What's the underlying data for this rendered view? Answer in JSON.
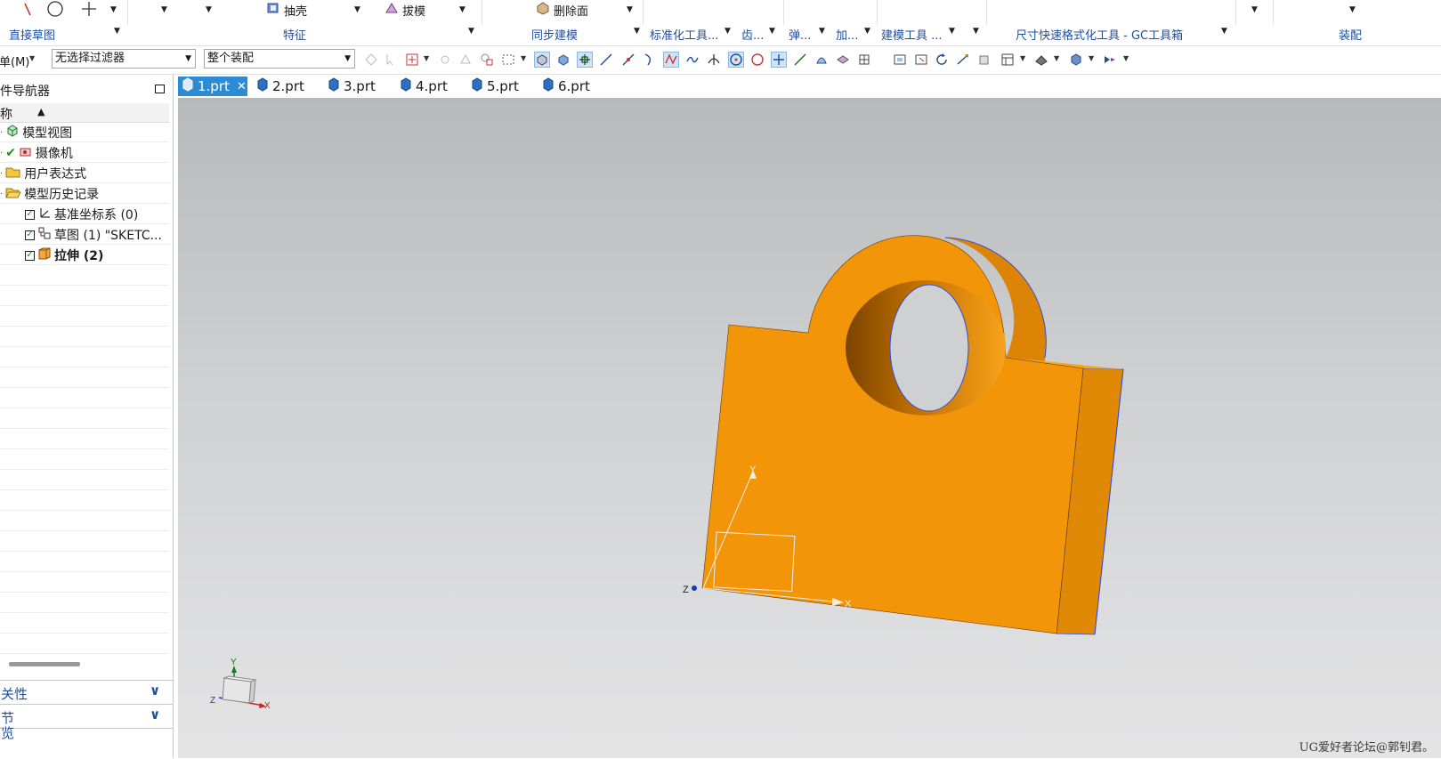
{
  "ribbon": {
    "items": [
      "抽壳",
      "拔模",
      "删除面"
    ],
    "groups": [
      "直接草图",
      "特征",
      "同步建模",
      "标准化工具...",
      "齿...",
      "弹...",
      "加...",
      "建模工具 ...",
      "尺寸快速格式化工具 - GC工具箱",
      "装配"
    ]
  },
  "toolbar": {
    "menu_label": "菜单(M)",
    "filter_value": "无选择过滤器",
    "scope_value": "整个装配"
  },
  "navigator": {
    "title": "部件导航器",
    "column_name": "名称",
    "items": [
      {
        "label": "模型视图",
        "icon": "model-view-icon"
      },
      {
        "label": "摄像机",
        "icon": "camera-icon"
      },
      {
        "label": "用户表达式",
        "icon": "folder-icon"
      },
      {
        "label": "模型历史记录",
        "icon": "folder-open-icon"
      },
      {
        "label": "基准坐标系 (0)",
        "icon": "datum-csys-icon"
      },
      {
        "label": "草图 (1) \"SKETC...",
        "icon": "sketch-icon"
      },
      {
        "label": "拉伸 (2)",
        "icon": "extrude-icon"
      }
    ],
    "panels": [
      "相关性",
      "细节",
      "预览"
    ]
  },
  "tabs": [
    {
      "label": "1.prt",
      "active": true
    },
    {
      "label": "2.prt",
      "active": false
    },
    {
      "label": "3.prt",
      "active": false
    },
    {
      "label": "4.prt",
      "active": false
    },
    {
      "label": "5.prt",
      "active": false
    },
    {
      "label": "6.prt",
      "active": false
    }
  ],
  "viewport": {
    "model_color": "#f39508",
    "axis_labels": {
      "x": "X",
      "y": "Y",
      "z": "Z"
    },
    "watermark": "UG爱好者论坛@郭钊君。"
  }
}
